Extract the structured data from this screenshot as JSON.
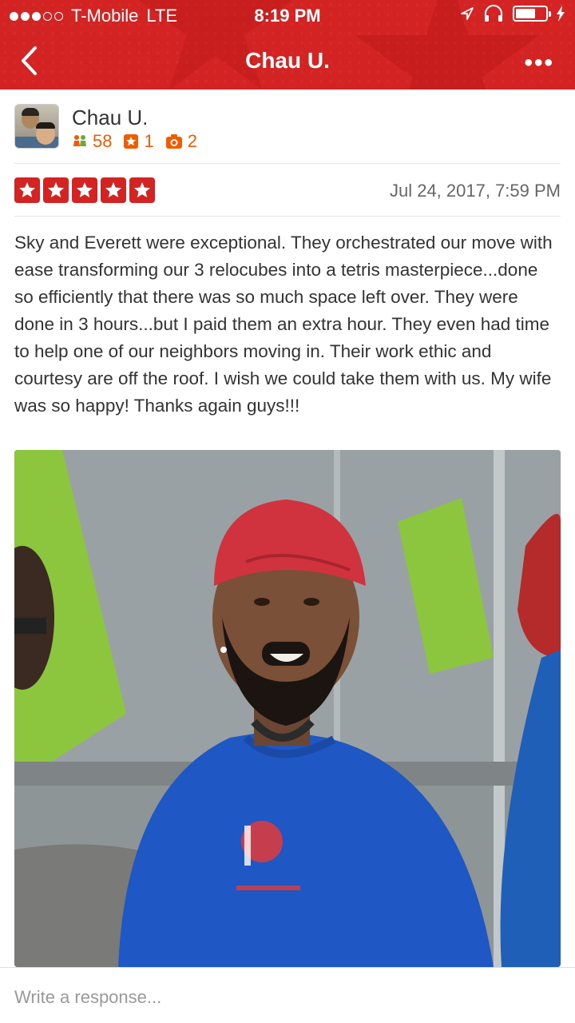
{
  "status_bar": {
    "carrier": "T-Mobile",
    "network": "LTE",
    "time": "8:19 PM"
  },
  "nav": {
    "title": "Chau U.",
    "more_label": "•••"
  },
  "user": {
    "name": "Chau U.",
    "friends": "58",
    "reviews": "1",
    "photos": "2"
  },
  "review": {
    "rating": 5,
    "date": "Jul 24, 2017, 7:59 PM",
    "text": "Sky and Everett were exceptional. They orchestrated our move with ease transforming our 3 relocubes into a tetris masterpiece...done so efficiently that there was so much space left over. They were done in 3 hours...but I paid them an extra hour. They even had time to help one of our neighbors moving in. Their work ethic and courtesy are off the roof. I wish we could take them with us. My wife was so happy! Thanks again guys!!!"
  },
  "response": {
    "placeholder": "Write a response..."
  },
  "colors": {
    "brand_red": "#d32323",
    "stat_orange": "#f15c00"
  },
  "icons": {
    "back": "chevron-left-icon",
    "more": "more-dots-icon",
    "friends": "friends-icon",
    "reviews": "star-box-icon",
    "photos": "camera-icon",
    "stars": "star-icon"
  }
}
